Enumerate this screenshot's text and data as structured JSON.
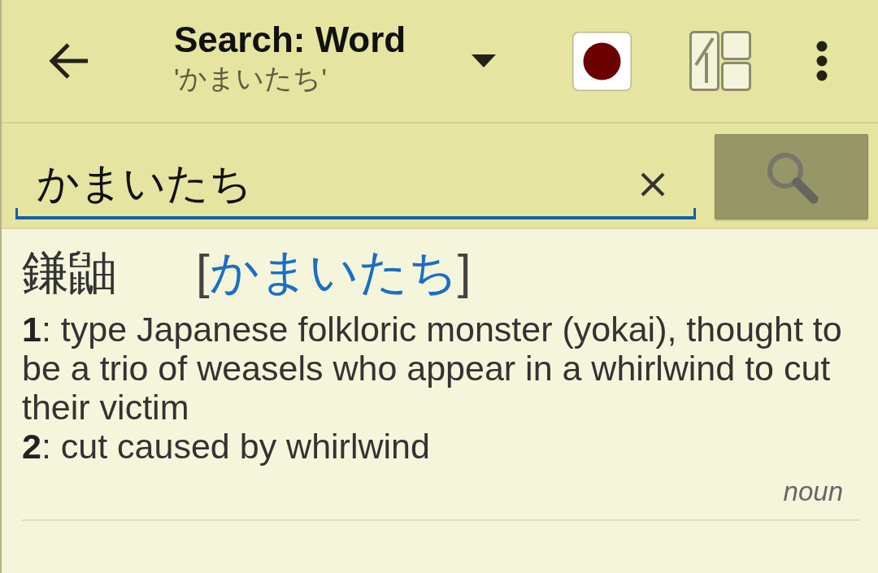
{
  "toolbar": {
    "title": "Search: Word",
    "subtitle": "'かまいたち'"
  },
  "search": {
    "value": "かまいたち"
  },
  "entries": [
    {
      "headword": "鎌鼬",
      "bracket_open": "[",
      "reading": "かまいたち",
      "bracket_close": "]",
      "senses": [
        {
          "text": "**1**: type Japanese folkloric monster (yokai), thought to be a trio of weasels who appear in a whirlwind to cut their victim"
        },
        {
          "text": "**2**: cut caused by whirlwind"
        }
      ],
      "part_of_speech": "noun"
    }
  ]
}
